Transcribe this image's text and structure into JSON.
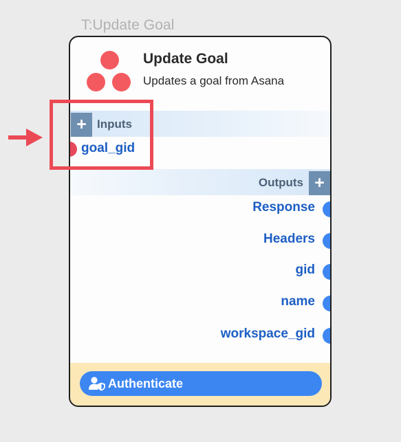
{
  "node": {
    "caption": "T:Update Goal",
    "title": "Update Goal",
    "subtitle": "Updates a goal from Asana",
    "logo_icon": "asana-logo",
    "logo_color": "#f35a5f"
  },
  "inputs": {
    "section_label": "Inputs",
    "add_label": "+",
    "ports": [
      {
        "label": "goal_gid",
        "dot_color": "#e6485c"
      }
    ]
  },
  "outputs": {
    "section_label": "Outputs",
    "add_label": "+",
    "ports": [
      {
        "label": "Response"
      },
      {
        "label": "Headers"
      },
      {
        "label": "gid"
      },
      {
        "label": "name"
      },
      {
        "label": "workspace_gid"
      }
    ],
    "dot_color": "#3e86f2"
  },
  "auth": {
    "label": "Authenticate",
    "icon": "user-shield-icon",
    "button_color": "#3c86f2",
    "footer_color": "#fbe8b6"
  },
  "annotation": {
    "highlight_color": "#eb4a55",
    "arrow_icon": "right-arrow-icon"
  }
}
